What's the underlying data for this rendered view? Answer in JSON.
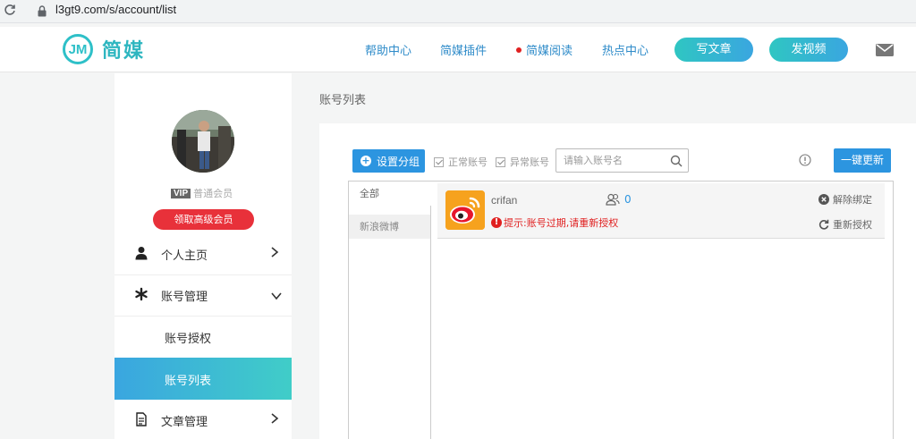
{
  "browser": {
    "url": "l3gt9.com/s/account/list"
  },
  "header": {
    "logo_mark": "JM",
    "logo_text": "简媒",
    "nav": [
      "帮助中心",
      "简媒插件",
      "简媒阅读",
      "热点中心"
    ],
    "write_button": "写文章",
    "video_button": "发视频"
  },
  "sidebar": {
    "vip_badge": "VIP",
    "member_level": "普通会员",
    "upgrade_button": "领取高级会员",
    "menu": {
      "home": "个人主页",
      "account_manage": "账号管理",
      "account_auth": "账号授权",
      "account_list": "账号列表",
      "article_manage": "文章管理"
    }
  },
  "main": {
    "breadcrumb": "账号列表",
    "toolbar": {
      "group_button": "设置分组",
      "normal_filter": "正常账号",
      "abnormal_filter": "异常账号",
      "search_placeholder": "请输入账号名",
      "update_button": "一键更新"
    },
    "groups": [
      "全部",
      "新浪微博"
    ],
    "accounts": [
      {
        "name": "crifan",
        "fans_count": "0",
        "platform_icon": "weibo-icon",
        "warning": "提示:账号过期,请重新授权",
        "unbind_label": "解除绑定",
        "reauth_label": "重新授权"
      }
    ]
  },
  "colors": {
    "brand": "#2ec0c8",
    "primary": "#2c95e0",
    "danger": "#e02020",
    "upgrade": "#e8313a"
  }
}
